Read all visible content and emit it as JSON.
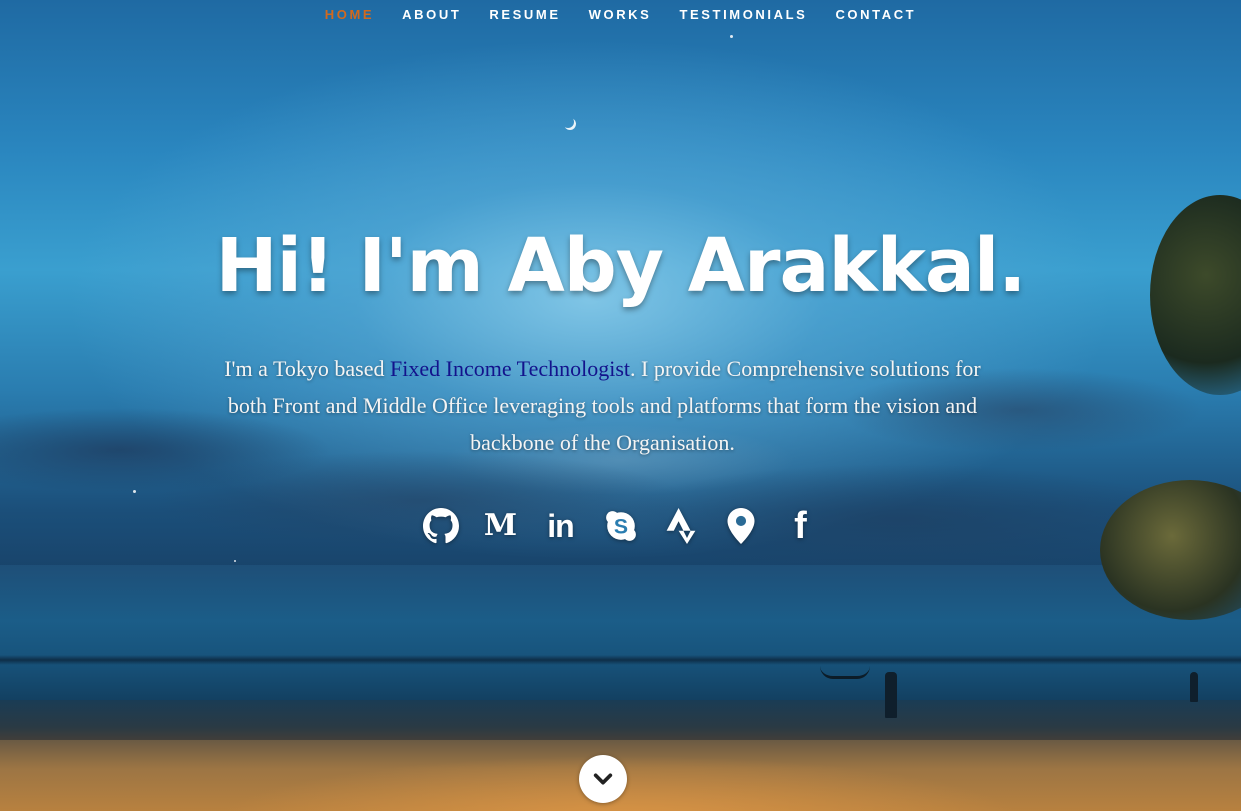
{
  "nav": {
    "items": [
      {
        "label": "HOME",
        "active": true
      },
      {
        "label": "ABOUT",
        "active": false
      },
      {
        "label": "RESUME",
        "active": false
      },
      {
        "label": "WORKS",
        "active": false
      },
      {
        "label": "TESTIMONIALS",
        "active": false
      },
      {
        "label": "CONTACT",
        "active": false
      }
    ],
    "active_color": "#d2691e"
  },
  "hero": {
    "title": "Hi! I'm Aby Arakkal.",
    "description_before": "I'm a Tokyo based ",
    "description_highlight": "Fixed Income Technologist",
    "description_after": ". I provide Comprehensive solutions for both Front and Middle Office leveraging tools and platforms that form the vision and backbone of the Organisation.",
    "highlight_color": "#13138c"
  },
  "social": {
    "icons": [
      "github-icon",
      "medium-icon",
      "linkedin-icon",
      "skype-icon",
      "strava-icon",
      "map-pin-icon",
      "facebook-icon"
    ],
    "medium_glyph": "M",
    "linkedin_glyph": "in",
    "facebook_glyph": "f"
  },
  "scroll": {
    "icon": "chevron-down-icon"
  }
}
